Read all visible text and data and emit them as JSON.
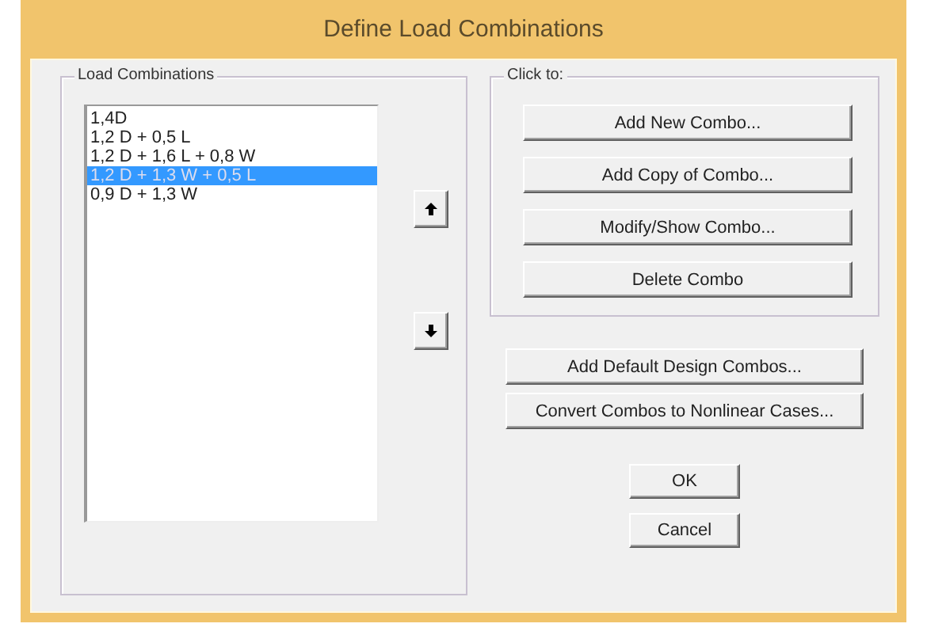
{
  "window": {
    "title": "Define Load Combinations"
  },
  "load_combinations": {
    "label": "Load Combinations",
    "items": [
      {
        "label": "1,4D",
        "selected": false
      },
      {
        "label": "1,2 D + 0,5 L",
        "selected": false
      },
      {
        "label": "1,2 D + 1,6 L + 0,8 W",
        "selected": false
      },
      {
        "label": "1,2 D + 1,3 W + 0,5 L",
        "selected": true
      },
      {
        "label": "0,9 D + 1,3 W",
        "selected": false
      }
    ]
  },
  "click_to": {
    "label": "Click to:",
    "buttons": [
      "Add New Combo...",
      "Add Copy of Combo...",
      "Modify/Show Combo...",
      "Delete Combo"
    ]
  },
  "other_buttons": [
    "Add Default Design Combos...",
    "Convert Combos to Nonlinear Cases..."
  ],
  "dialog_buttons": [
    "OK",
    "Cancel"
  ]
}
